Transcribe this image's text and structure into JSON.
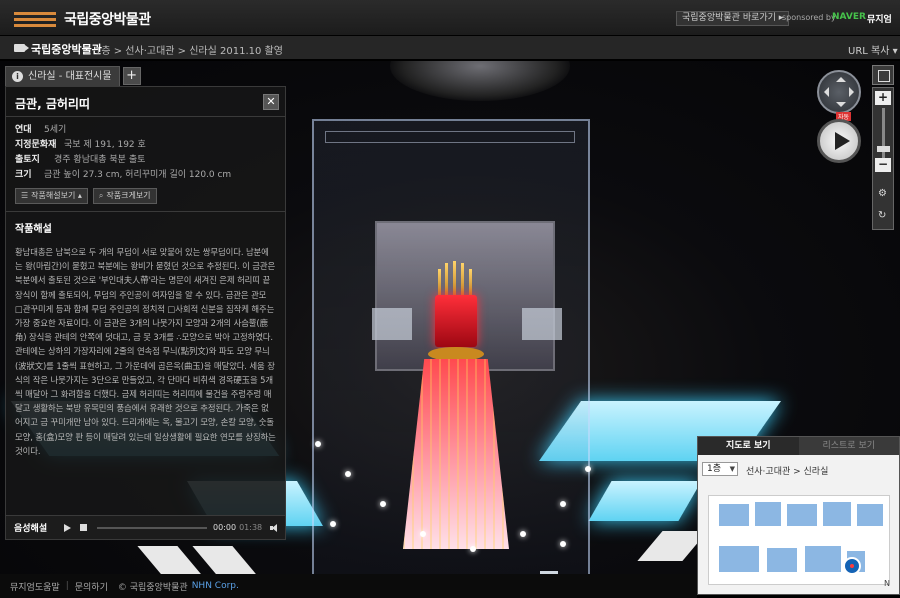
{
  "header": {
    "title": "국립중앙박물관",
    "shortcut_label": "국립중앙박물관 바로가기 ▸",
    "sponsor_label": "sponsored by",
    "naver_label": "NAVER",
    "museum_label": "뮤지엄"
  },
  "subbar": {
    "name": "국립중앙박물관",
    "path": "1층 > 선사·고대관 > 신라실     2011.10 촬영",
    "url_copy": "URL 복사 ▾"
  },
  "info_tab": {
    "label": "신라실 - 대표전시물",
    "plus": "+"
  },
  "artifact": {
    "title": "금관, 금허리띠",
    "close": "✕",
    "meta": [
      {
        "key": "연대",
        "value": "5세기"
      },
      {
        "key": "지정문화재",
        "value": "국보 제 191, 192 호"
      },
      {
        "key": "출토지",
        "value": "경주 황남대총 북분 출토"
      },
      {
        "key": "크기",
        "value": "금관 높이 27.3 cm, 허리꾸미개 길이 120.0 cm"
      }
    ],
    "btn_desc": "작품해설보기 ▴",
    "btn_zoom": "작품크게보기",
    "section_title": "작품해설",
    "description": "황남대총은 남북으로 두 개의 무덤이 서로 맞붙어 있는 쌍무덤이다. 남분에는 왕(마립간)이 묻혔고 북분에는 왕비가 묻혔던 것으로 추정된다. 이 금관은 북분에서 출토된 것으로 '부인대夫人帶'라는 명문이 새겨진 은제 허리띠 끝장식이 함께 출토되어, 무덤의 주인공이 여자임을 알 수 있다. 금관은 관모 □관꾸미게 등과 함께 무덤 주인공의 정치적 □사회적 신분을 짐작케 해주는 가장 중요한 자료이다. 이 금관은 3개의 나뭇가지 모양과 2개의 사슴뿔(鹿角) 장식을 관테의 안쪽에 덧대고, 금 못 3개를 ∴모양으로 박아 고정하였다. 관테에는 상하의 가장자리에 2줄의 연속점 무늬(點列文)와 파도 모양 무늬(波狀文)를 1줄씩 표현하고, 그 가운데에 곱은옥(曲玉)을 매달았다. 세움 장식의 작은 나뭇가지는 3단으로 만들었고, 각 단마다 비취색 경옥硬玉을 5개씩 매달아 그 화려함을 더했다. 금제 허리띠는 허리띠에 물건을 주렁주렁 매달고 생활하는 북방 유목민의 풍습에서 유래한 것으로 추정된다. 가죽은 없어지고 금 꾸미개만 남아 있다. 드리개에는 옥, 물고기 모양, 손칼 모양, 숫돌 모양, 홈(盒)모양 판 등이 매달려 있는데 일상생활에 필요한 연모를 상징하는 것이다."
  },
  "audio": {
    "label": "음성해설",
    "current": "00:00",
    "total": "01:38"
  },
  "map": {
    "tab_map": "지도로 보기",
    "tab_list": "리스트로 보기",
    "floor": "1층",
    "path": "선사·고대관 > 신라실",
    "compass": "N"
  },
  "controls": {
    "zoom_in": "+",
    "zoom_out": "−",
    "badge": "자동"
  },
  "footer": {
    "help": "뮤지엄도움말",
    "contact": "문의하기",
    "copyright": "© 국립중앙박물관",
    "nhn": "NHN Corp."
  },
  "colors": {
    "accent_orange": "#d98a3c",
    "naver_green": "#46c24b",
    "map_blue": "#8cb7e3"
  }
}
